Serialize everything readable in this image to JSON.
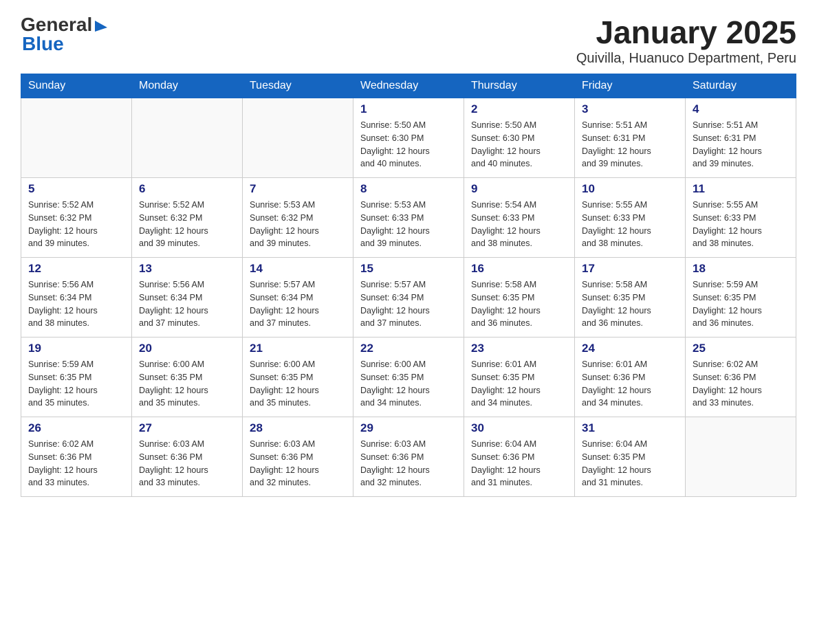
{
  "header": {
    "logo_general": "General",
    "logo_blue": "Blue",
    "title": "January 2025",
    "subtitle": "Quivilla, Huanuco Department, Peru"
  },
  "calendar": {
    "days_of_week": [
      "Sunday",
      "Monday",
      "Tuesday",
      "Wednesday",
      "Thursday",
      "Friday",
      "Saturday"
    ],
    "weeks": [
      [
        {
          "day": "",
          "info": ""
        },
        {
          "day": "",
          "info": ""
        },
        {
          "day": "",
          "info": ""
        },
        {
          "day": "1",
          "info": "Sunrise: 5:50 AM\nSunset: 6:30 PM\nDaylight: 12 hours\nand 40 minutes."
        },
        {
          "day": "2",
          "info": "Sunrise: 5:50 AM\nSunset: 6:30 PM\nDaylight: 12 hours\nand 40 minutes."
        },
        {
          "day": "3",
          "info": "Sunrise: 5:51 AM\nSunset: 6:31 PM\nDaylight: 12 hours\nand 39 minutes."
        },
        {
          "day": "4",
          "info": "Sunrise: 5:51 AM\nSunset: 6:31 PM\nDaylight: 12 hours\nand 39 minutes."
        }
      ],
      [
        {
          "day": "5",
          "info": "Sunrise: 5:52 AM\nSunset: 6:32 PM\nDaylight: 12 hours\nand 39 minutes."
        },
        {
          "day": "6",
          "info": "Sunrise: 5:52 AM\nSunset: 6:32 PM\nDaylight: 12 hours\nand 39 minutes."
        },
        {
          "day": "7",
          "info": "Sunrise: 5:53 AM\nSunset: 6:32 PM\nDaylight: 12 hours\nand 39 minutes."
        },
        {
          "day": "8",
          "info": "Sunrise: 5:53 AM\nSunset: 6:33 PM\nDaylight: 12 hours\nand 39 minutes."
        },
        {
          "day": "9",
          "info": "Sunrise: 5:54 AM\nSunset: 6:33 PM\nDaylight: 12 hours\nand 38 minutes."
        },
        {
          "day": "10",
          "info": "Sunrise: 5:55 AM\nSunset: 6:33 PM\nDaylight: 12 hours\nand 38 minutes."
        },
        {
          "day": "11",
          "info": "Sunrise: 5:55 AM\nSunset: 6:33 PM\nDaylight: 12 hours\nand 38 minutes."
        }
      ],
      [
        {
          "day": "12",
          "info": "Sunrise: 5:56 AM\nSunset: 6:34 PM\nDaylight: 12 hours\nand 38 minutes."
        },
        {
          "day": "13",
          "info": "Sunrise: 5:56 AM\nSunset: 6:34 PM\nDaylight: 12 hours\nand 37 minutes."
        },
        {
          "day": "14",
          "info": "Sunrise: 5:57 AM\nSunset: 6:34 PM\nDaylight: 12 hours\nand 37 minutes."
        },
        {
          "day": "15",
          "info": "Sunrise: 5:57 AM\nSunset: 6:34 PM\nDaylight: 12 hours\nand 37 minutes."
        },
        {
          "day": "16",
          "info": "Sunrise: 5:58 AM\nSunset: 6:35 PM\nDaylight: 12 hours\nand 36 minutes."
        },
        {
          "day": "17",
          "info": "Sunrise: 5:58 AM\nSunset: 6:35 PM\nDaylight: 12 hours\nand 36 minutes."
        },
        {
          "day": "18",
          "info": "Sunrise: 5:59 AM\nSunset: 6:35 PM\nDaylight: 12 hours\nand 36 minutes."
        }
      ],
      [
        {
          "day": "19",
          "info": "Sunrise: 5:59 AM\nSunset: 6:35 PM\nDaylight: 12 hours\nand 35 minutes."
        },
        {
          "day": "20",
          "info": "Sunrise: 6:00 AM\nSunset: 6:35 PM\nDaylight: 12 hours\nand 35 minutes."
        },
        {
          "day": "21",
          "info": "Sunrise: 6:00 AM\nSunset: 6:35 PM\nDaylight: 12 hours\nand 35 minutes."
        },
        {
          "day": "22",
          "info": "Sunrise: 6:00 AM\nSunset: 6:35 PM\nDaylight: 12 hours\nand 34 minutes."
        },
        {
          "day": "23",
          "info": "Sunrise: 6:01 AM\nSunset: 6:35 PM\nDaylight: 12 hours\nand 34 minutes."
        },
        {
          "day": "24",
          "info": "Sunrise: 6:01 AM\nSunset: 6:36 PM\nDaylight: 12 hours\nand 34 minutes."
        },
        {
          "day": "25",
          "info": "Sunrise: 6:02 AM\nSunset: 6:36 PM\nDaylight: 12 hours\nand 33 minutes."
        }
      ],
      [
        {
          "day": "26",
          "info": "Sunrise: 6:02 AM\nSunset: 6:36 PM\nDaylight: 12 hours\nand 33 minutes."
        },
        {
          "day": "27",
          "info": "Sunrise: 6:03 AM\nSunset: 6:36 PM\nDaylight: 12 hours\nand 33 minutes."
        },
        {
          "day": "28",
          "info": "Sunrise: 6:03 AM\nSunset: 6:36 PM\nDaylight: 12 hours\nand 32 minutes."
        },
        {
          "day": "29",
          "info": "Sunrise: 6:03 AM\nSunset: 6:36 PM\nDaylight: 12 hours\nand 32 minutes."
        },
        {
          "day": "30",
          "info": "Sunrise: 6:04 AM\nSunset: 6:36 PM\nDaylight: 12 hours\nand 31 minutes."
        },
        {
          "day": "31",
          "info": "Sunrise: 6:04 AM\nSunset: 6:35 PM\nDaylight: 12 hours\nand 31 minutes."
        },
        {
          "day": "",
          "info": ""
        }
      ]
    ]
  }
}
